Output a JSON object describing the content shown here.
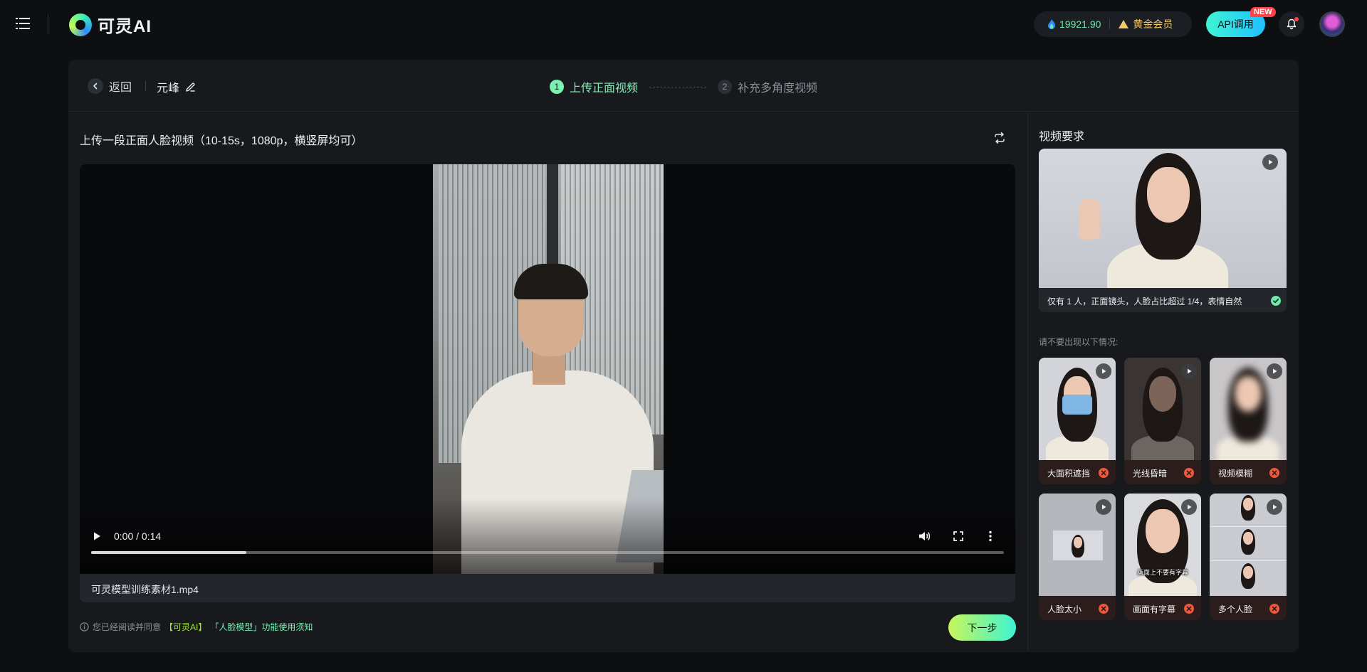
{
  "header": {
    "app_name": "可灵AI",
    "credits": "19921.90",
    "vip_label": "黄金会员",
    "api_label": "API调用",
    "new_badge": "NEW"
  },
  "card": {
    "back_label": "返回",
    "model_name": "元峰",
    "steps": [
      {
        "num": "1",
        "label": "上传正面视频"
      },
      {
        "num": "2",
        "label": "补充多角度视频"
      }
    ]
  },
  "upload": {
    "title": "上传一段正面人脸视频（10-15s，1080p，横竖屏均可）",
    "time": "0:00 / 0:14",
    "progress_fraction": 0.17,
    "file_name": "可灵模型训练素材1.mp4",
    "consent_prefix": "您已经阅读并同意",
    "consent_link1": "【可灵AI】",
    "consent_link2": "「人脸模型」功能使用须知",
    "next_label": "下一步"
  },
  "requirements": {
    "title": "视频要求",
    "good_caption": "仅有 1 人，正面镜头，人脸占比超过 1/4，表情自然",
    "warn_title": "请不要出现以下情况:",
    "bad_examples": [
      {
        "label": "大面积遮挡"
      },
      {
        "label": "光线昏暗"
      },
      {
        "label": "视频模糊"
      },
      {
        "label": "人脸太小"
      },
      {
        "label": "画面有字幕"
      },
      {
        "label": "多个人脸"
      }
    ],
    "subtitle_text": "画面上不要有字幕"
  }
}
